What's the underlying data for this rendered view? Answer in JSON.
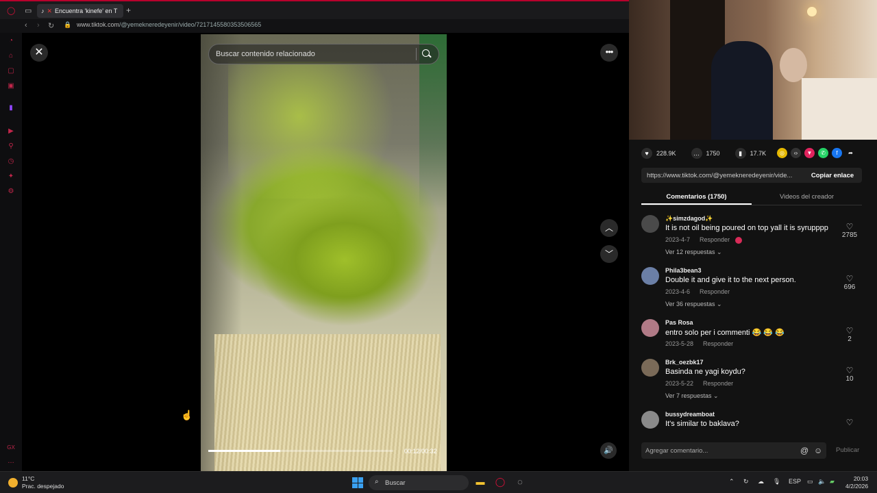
{
  "browser": {
    "tab_title": "Encuentra 'kinefe' en T",
    "new_tab": "+",
    "url_host": "www.tiktok.com",
    "url_path": "/@yemekneredeyenir/video/7217145580353506565"
  },
  "viewer": {
    "search_placeholder": "Buscar contenido relacionado",
    "progress": 0.39,
    "time": "00:12/00:32"
  },
  "stats": {
    "likes": "228.9K",
    "comments": "1750",
    "saves": "17.7K"
  },
  "share": {
    "link": "https://www.tiktok.com/@yemekneredeyenir/vide...",
    "copy_label": "Copiar enlace"
  },
  "tabs": {
    "comments": "Comentarios (1750)",
    "creator_videos": "Videos del creador"
  },
  "comments": [
    {
      "user": "✨simzdagod✨",
      "text": "It is not oil being poured on top yall it is syrupppp",
      "date": "2023-4-7",
      "reply": "Responder",
      "replies": "Ver 12 respuestas ⌄",
      "likes": "2785",
      "avatar_color": "#4a4a4a"
    },
    {
      "user": "Phila3bean3",
      "text": "Double it and give it to the next person.",
      "date": "2023-4-6",
      "reply": "Responder",
      "replies": "Ver 36 respuestas ⌄",
      "likes": "696",
      "avatar_color": "#6b7fa6"
    },
    {
      "user": "Pas Rosa",
      "text": "entro solo per i commenti 😂 😂 😂",
      "date": "2023-5-28",
      "reply": "Responder",
      "replies": "",
      "likes": "2",
      "avatar_color": "#b07a86"
    },
    {
      "user": "Brk_oezbk17",
      "text": "Basinda ne yagi koydu?",
      "date": "2023-5-22",
      "reply": "Responder",
      "replies": "Ver 7 respuestas ⌄",
      "likes": "10",
      "avatar_color": "#7a6a58"
    },
    {
      "user": "bussydreamboat",
      "text": "It's similar to baklava?",
      "date": "",
      "reply": "",
      "replies": "",
      "likes": "",
      "avatar_color": "#8a8a8a"
    }
  ],
  "composer": {
    "placeholder": "Agregar comentario...",
    "post_label": "Publicar"
  },
  "taskbar": {
    "temp": "11°C",
    "weather": "Prac. despejado",
    "search": "Buscar",
    "lang": "ESP",
    "time": "20:03",
    "date": "4/2/2026"
  }
}
